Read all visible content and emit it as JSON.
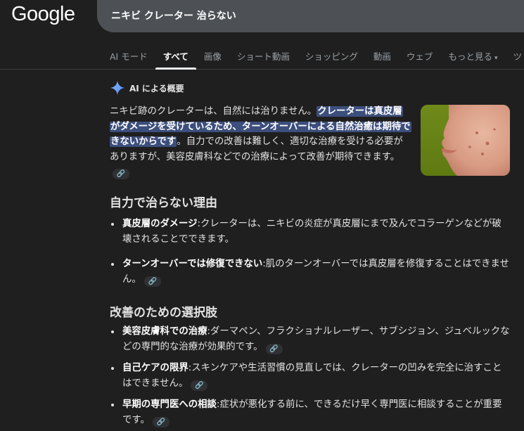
{
  "logo": "Google",
  "search": {
    "query": "ニキビ クレーター 治らない"
  },
  "tabs": [
    {
      "label": "AI モード"
    },
    {
      "label": "すべて"
    },
    {
      "label": "画像"
    },
    {
      "label": "ショート動画"
    },
    {
      "label": "ショッピング"
    },
    {
      "label": "動画"
    },
    {
      "label": "ウェブ"
    },
    {
      "label": "もっと見る"
    },
    {
      "label": "ツ"
    }
  ],
  "ai_overview": {
    "title": "AI による概要",
    "summary_plain1": "ニキビ跡のクレーターは、自然には治りません。",
    "summary_highlight": "クレーターは真皮層がダメージを受けているため、ターンオーバーによる自然治癒は期待できないからです",
    "summary_plain2": "。自力での改善は難しく、適切な治療を受ける必要がありますが、美容皮膚科などでの治療によって改善が期待できます。"
  },
  "section1": {
    "heading": "自力で治らない理由",
    "items": [
      {
        "bold": "真皮層のダメージ",
        "text": ":クレーターは、ニキビの炎症が真皮層にまで及んでコラーゲンなどが破壊されることでできます。"
      },
      {
        "bold": "ターンオーバーでは修復できない",
        "text": ":肌のターンオーバーでは真皮層を修復することはできません。"
      }
    ]
  },
  "section2": {
    "heading": "改善のための選択肢",
    "items": [
      {
        "bold": "美容皮膚科での治療",
        "text": ":ダーマペン、フラクショナルレーザー、サブシジョン、ジュベルックなどの専門的な治療が効果的です。"
      },
      {
        "bold": "自己ケアの限界",
        "text": ":スキンケアや生活習慣の見直しでは、クレーターの凹みを完全に治すことはできません。"
      },
      {
        "bold": "早期の専門医への相談",
        "text": ":症状が悪化する前に、できるだけ早く専門医に相談することが重要です。"
      }
    ]
  },
  "colors": {
    "background": "#1f1f1f",
    "highlight": "#3c4e7c",
    "searchbox": "#4d5156"
  }
}
